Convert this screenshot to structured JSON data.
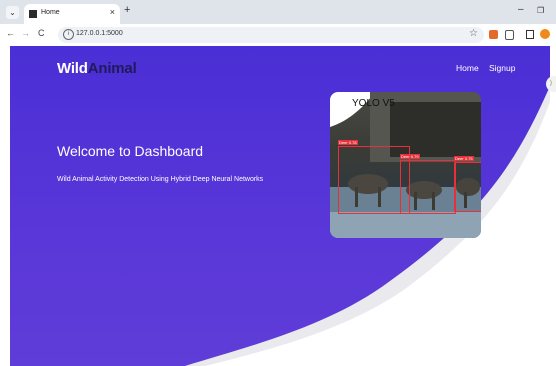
{
  "browser": {
    "tab_title": "Home",
    "tab_close": "×",
    "new_tab": "+",
    "menu": "⌄",
    "url": "127.0.0.1:5000",
    "back": "←",
    "forward": "→",
    "reload": "C",
    "star": "☆",
    "minimize": "–",
    "maximize": "❐"
  },
  "site": {
    "logo_part1": "Wild",
    "logo_part2": "Animal",
    "nav": [
      {
        "label": "Home"
      },
      {
        "label": "Signup"
      }
    ],
    "hero_title": "Welcome to Dashboard",
    "hero_subtitle": "Wild Animal Activity Detection Using Hybrid Deep Neural Networks",
    "image_caption": "YOLO V5",
    "detections": [
      {
        "label": "Deer 0.78"
      },
      {
        "label": "Deer 0.79"
      },
      {
        "label": "Deer 0.75"
      }
    ]
  },
  "colors": {
    "page_bg": "#4a2fd6",
    "logo_accent": "#201a5a",
    "box": "#e8303a"
  }
}
